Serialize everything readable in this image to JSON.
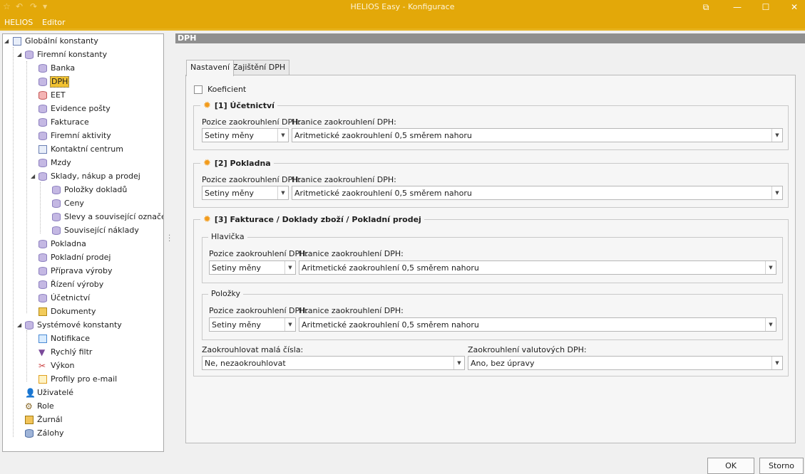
{
  "window": {
    "title": "HELIOS Easy - Konfigurace",
    "restore": "⧉",
    "minimize": "—",
    "maximize": "☐",
    "close": "✕"
  },
  "menu": {
    "items": [
      "HELIOS",
      "Editor"
    ]
  },
  "tree": {
    "root": "Globální konstanty",
    "firm": "Firemní konstanty",
    "banka": "Banka",
    "dph": "DPH",
    "eet": "EET",
    "evidence": "Evidence pošty",
    "fakturace": "Fakturace",
    "aktivity": "Firemní aktivity",
    "kontakt": "Kontaktní centrum",
    "mzdy": "Mzdy",
    "sklady": "Sklady, nákup a prodej",
    "polozky": "Položky dokladů",
    "ceny": "Ceny",
    "slevy": "Slevy a související označení",
    "naklady": "Související náklady",
    "pokladna": "Pokladna",
    "pprodej": "Pokladní prodej",
    "priprava": "Příprava výroby",
    "rizeni": "Řízení výroby",
    "ucetnictvi": "Účetnictví",
    "dokumenty": "Dokumenty",
    "sys": "Systémové konstanty",
    "notifikace": "Notifikace",
    "filtr": "Rychlý filtr",
    "vykon": "Výkon",
    "profily": "Profily pro e-mail",
    "uzivatele": "Uživatelé",
    "role": "Role",
    "zurnal": "Žurnál",
    "zalohy": "Zálohy"
  },
  "header": {
    "title": "DPH"
  },
  "tabs": [
    "Nastavení",
    "Zajištění DPH"
  ],
  "koeficient": "Koeficient",
  "labels": {
    "pozice": "Pozice zaokrouhlení DPH:",
    "hranice": "Hranice zaokrouhlení DPH:"
  },
  "values": {
    "setiny": "Setiny měny",
    "aritm": "Aritmetické zaokrouhlení 0,5 směrem nahoru"
  },
  "groups": {
    "ucto": "[1] Účetnictví",
    "pokladna": "[2] Pokladna",
    "faktury": "[3] Fakturace / Doklady zboží / Pokladní prodej",
    "hlavicka": "Hlavička",
    "polozky": "Položky"
  },
  "bottom": {
    "male_label": "Zaokrouhlovat malá čísla:",
    "male_value": "Ne, nezaokrouhlovat",
    "valut_label": "Zaokrouhlení valutových DPH:",
    "valut_value": "Ano, bez úpravy"
  },
  "buttons": {
    "ok": "OK",
    "storno": "Storno"
  },
  "colors": {
    "accent": "#e3a809",
    "selection": "#f1c232"
  }
}
